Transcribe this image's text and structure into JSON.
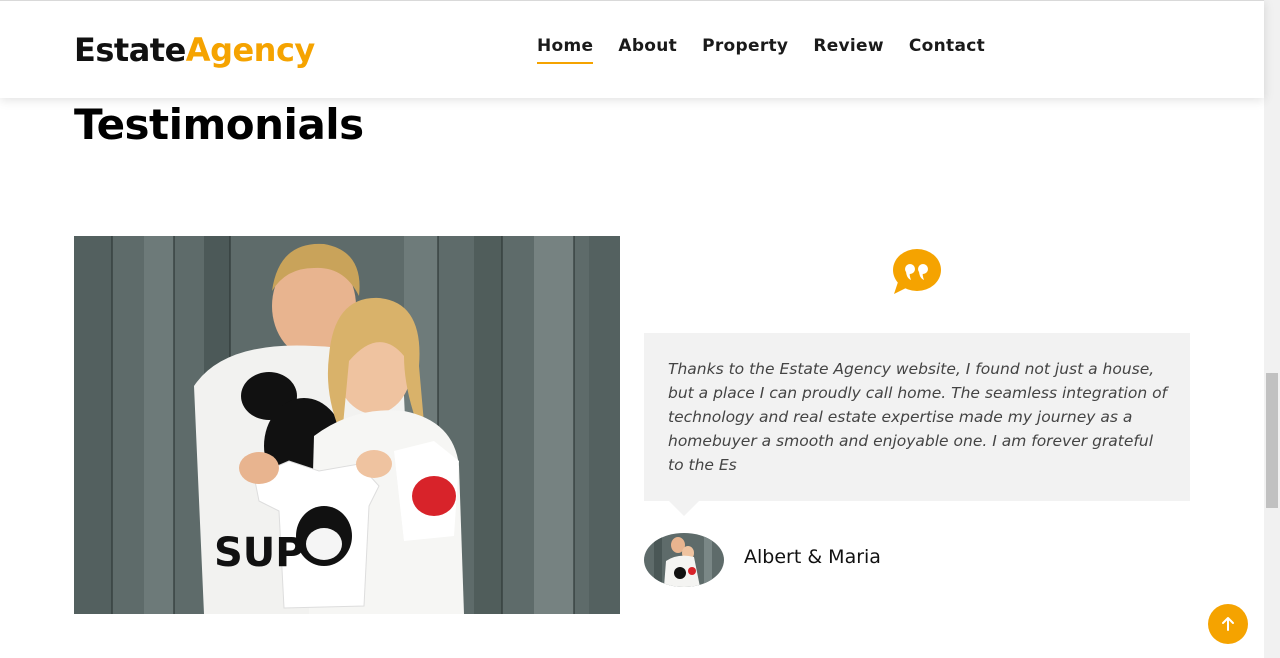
{
  "brand": {
    "part1": "Estate",
    "part2": "Agency"
  },
  "nav": [
    {
      "label": "Home",
      "active": true
    },
    {
      "label": "About"
    },
    {
      "label": "Property"
    },
    {
      "label": "Review"
    },
    {
      "label": "Contact"
    }
  ],
  "section": {
    "title": "Testimonials"
  },
  "testimonial": {
    "quote": "Thanks to the Estate Agency website, I found not just a house, but a place I can proudly call home. The seamless integration of technology and real estate expertise made my journey as a homebuyer a smooth and enjoyable one. I am forever grateful to the Es",
    "author": "Albert & Maria"
  },
  "colors": {
    "accent": "#f5a300",
    "quote_bg": "#f2f2f2"
  },
  "icons": {
    "quote": "quote-bubble-icon",
    "back_to_top": "arrow-up-icon"
  }
}
